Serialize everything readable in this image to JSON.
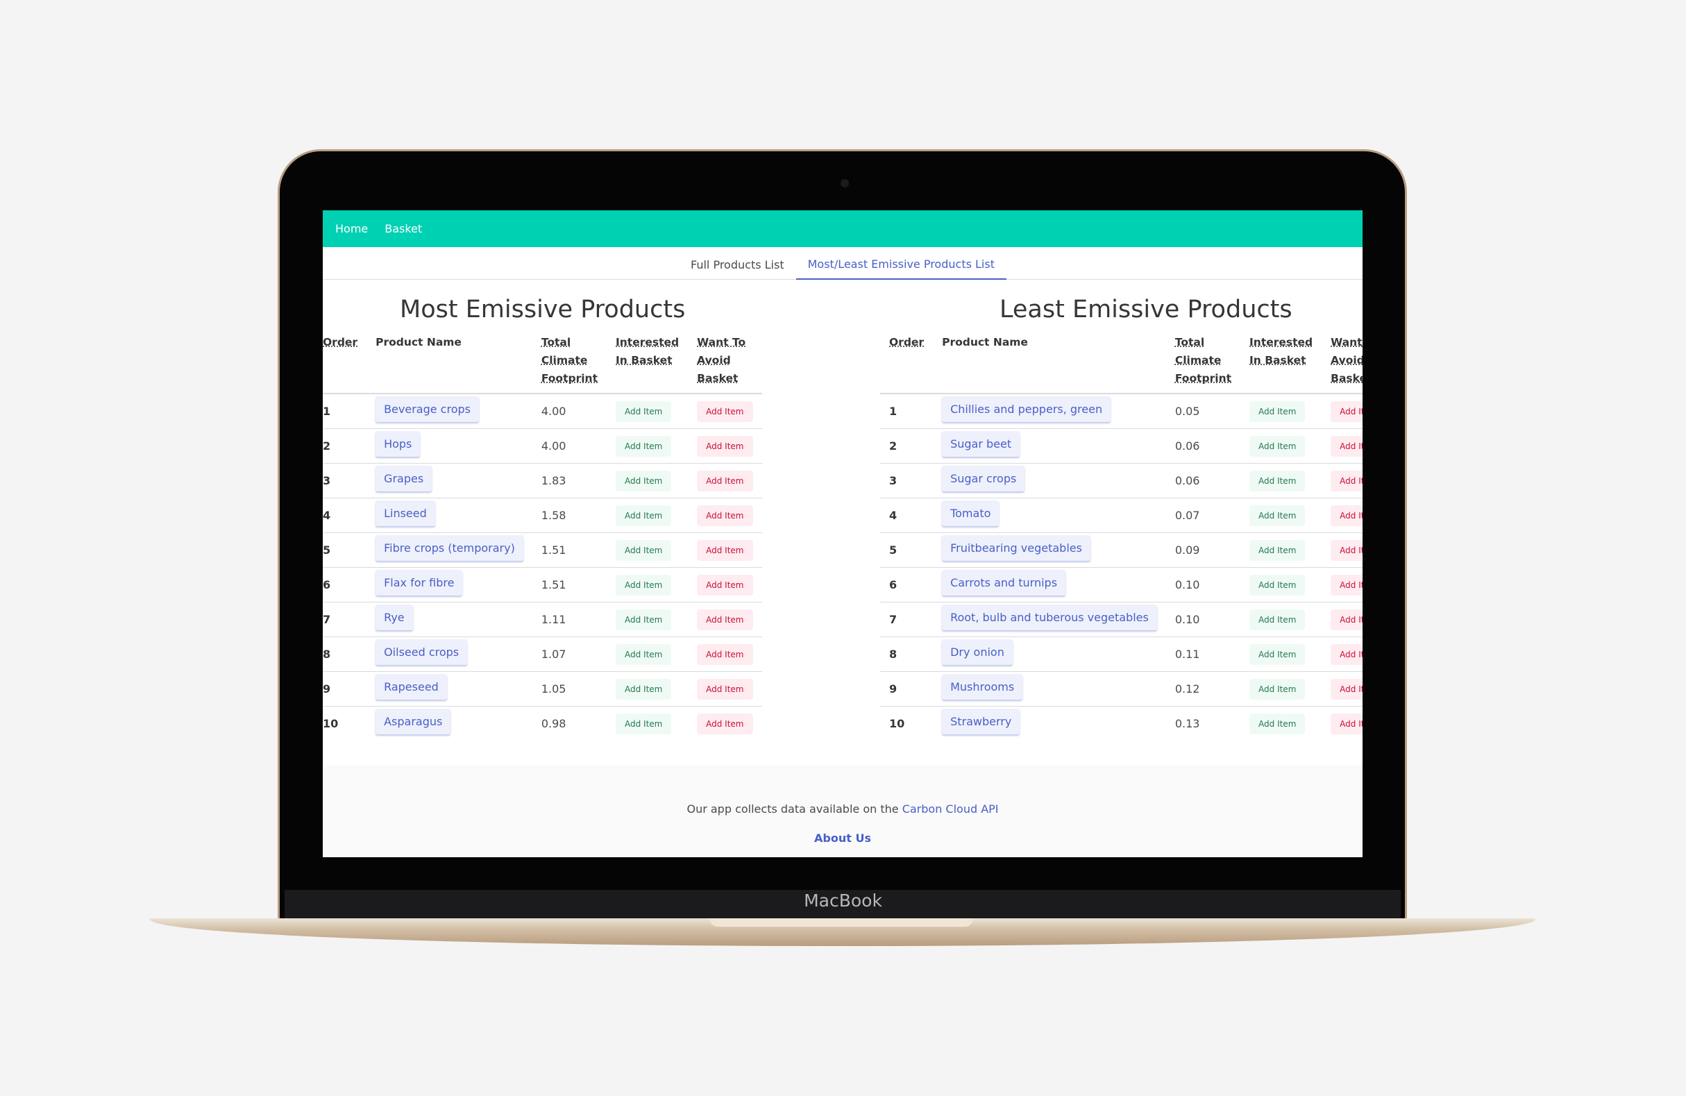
{
  "device": {
    "brand": "MacBook"
  },
  "nav": {
    "items": [
      "Home",
      "Basket"
    ]
  },
  "tabs": [
    {
      "label": "Full Products List",
      "active": false
    },
    {
      "label": "Most/Least Emissive Products List",
      "active": true
    }
  ],
  "table_headers": {
    "order": "Order",
    "product": "Product Name",
    "footprint": [
      "Total",
      "Climate",
      "Footprint"
    ],
    "interested": [
      "Interested",
      "In Basket"
    ],
    "avoid": [
      "Want To",
      "Avoid",
      "Basket"
    ]
  },
  "add_label": "Add Item",
  "most": {
    "title": "Most Emissive Products",
    "rows": [
      {
        "order": "1",
        "name": "Beverage crops",
        "value": "4.00"
      },
      {
        "order": "2",
        "name": "Hops",
        "value": "4.00"
      },
      {
        "order": "3",
        "name": "Grapes",
        "value": "1.83"
      },
      {
        "order": "4",
        "name": "Linseed",
        "value": "1.58"
      },
      {
        "order": "5",
        "name": "Fibre crops (temporary)",
        "value": "1.51"
      },
      {
        "order": "6",
        "name": "Flax for fibre",
        "value": "1.51"
      },
      {
        "order": "7",
        "name": "Rye",
        "value": "1.11"
      },
      {
        "order": "8",
        "name": "Oilseed crops",
        "value": "1.07"
      },
      {
        "order": "9",
        "name": "Rapeseed",
        "value": "1.05"
      },
      {
        "order": "10",
        "name": "Asparagus",
        "value": "0.98"
      }
    ]
  },
  "least": {
    "title": "Least Emissive Products",
    "rows": [
      {
        "order": "1",
        "name": "Chillies and peppers, green",
        "value": "0.05"
      },
      {
        "order": "2",
        "name": "Sugar beet",
        "value": "0.06"
      },
      {
        "order": "3",
        "name": "Sugar crops",
        "value": "0.06"
      },
      {
        "order": "4",
        "name": "Tomato",
        "value": "0.07"
      },
      {
        "order": "5",
        "name": "Fruitbearing vegetables",
        "value": "0.09"
      },
      {
        "order": "6",
        "name": "Carrots and turnips",
        "value": "0.10"
      },
      {
        "order": "7",
        "name": "Root, bulb and tuberous vegetables",
        "value": "0.10"
      },
      {
        "order": "8",
        "name": "Dry onion",
        "value": "0.11"
      },
      {
        "order": "9",
        "name": "Mushrooms",
        "value": "0.12"
      },
      {
        "order": "10",
        "name": "Strawberry",
        "value": "0.13"
      }
    ]
  },
  "footer": {
    "text": "Our app collects data available on the",
    "link": "Carbon Cloud API",
    "about": "About Us"
  },
  "colors": {
    "nav": "#00d1b2",
    "link": "#485fc7",
    "success": "#257953",
    "danger": "#cc0f35"
  }
}
